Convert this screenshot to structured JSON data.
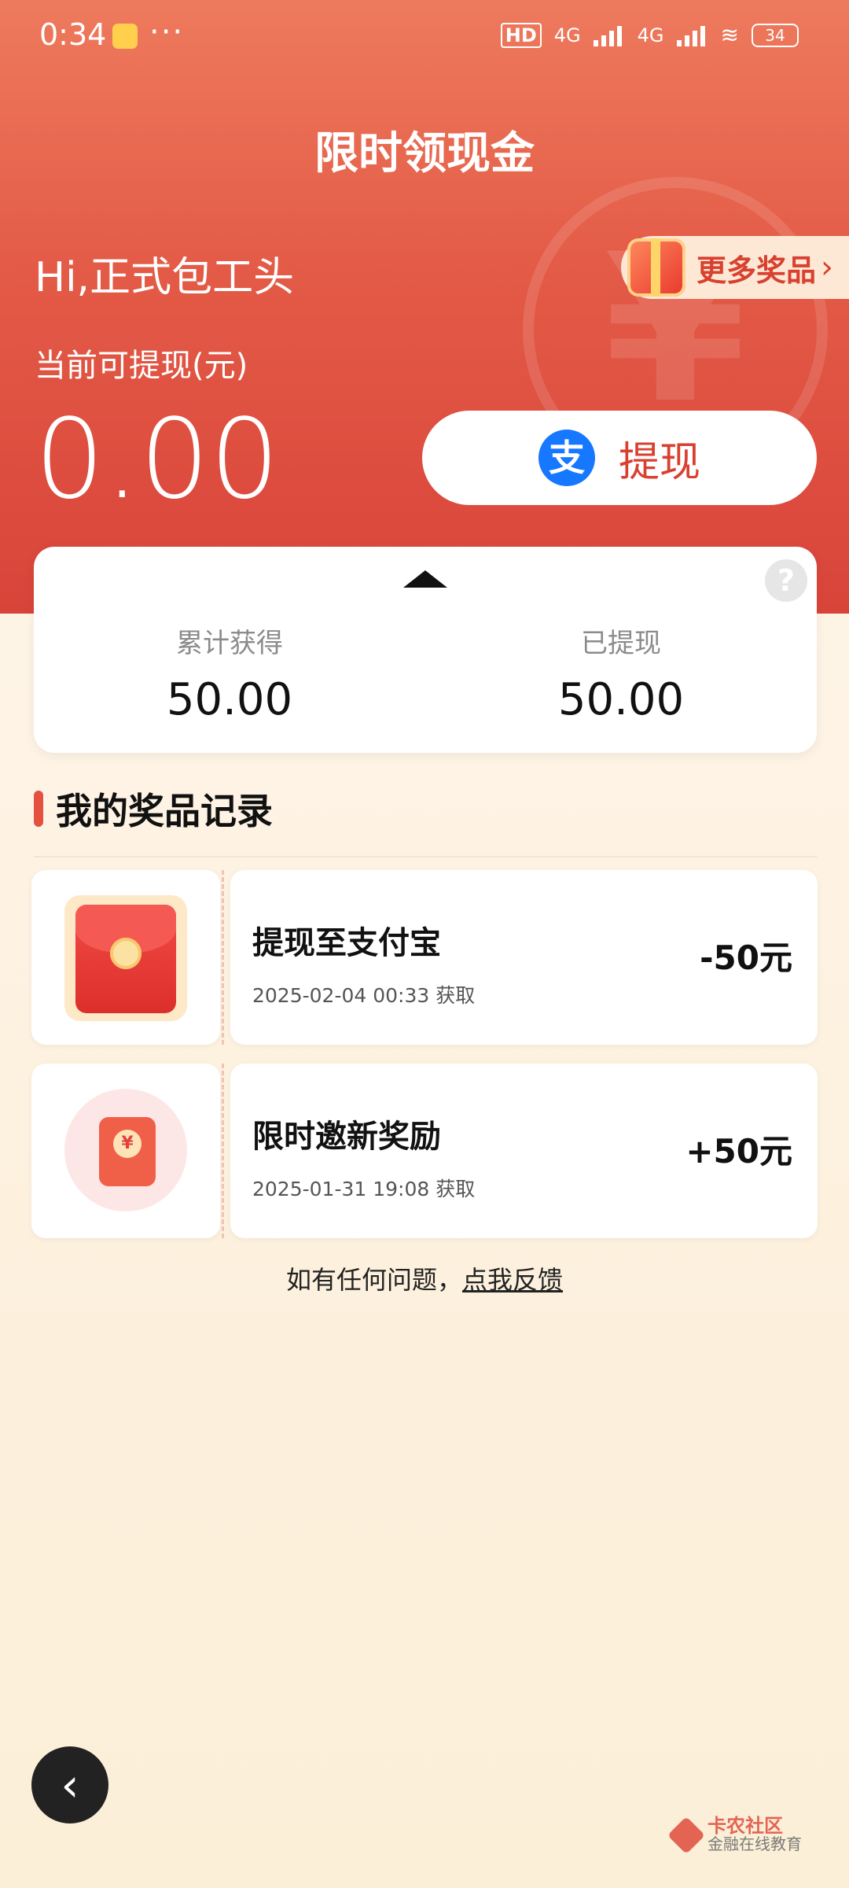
{
  "status_bar": {
    "time": "0:34",
    "more": "···",
    "network_1": "4G",
    "network_2": "4G",
    "battery": "34"
  },
  "header": {
    "title": "限时领现金"
  },
  "user": {
    "greeting": "Hi,正式包工头"
  },
  "more_prizes": {
    "label": "更多奖品",
    "chevron": "›"
  },
  "balance": {
    "label": "当前可提现(元)",
    "value": "0.00"
  },
  "withdraw": {
    "label": "提现",
    "icon": "alipay-icon"
  },
  "stats": {
    "help_symbol": "?",
    "total_label": "累计获得",
    "total_value": "50.00",
    "withdrawn_label": "已提现",
    "withdrawn_value": "50.00"
  },
  "records": {
    "section_title": "我的奖品记录",
    "items": [
      {
        "name": "提现至支付宝",
        "date": "2025-02-04 00:33 获取",
        "amount": "-50元"
      },
      {
        "name": "限时邀新奖励",
        "date": "2025-01-31 19:08 获取",
        "amount": "+50元"
      }
    ]
  },
  "footer": {
    "prefix": "如有任何问题，",
    "link": "点我反馈"
  },
  "back": {
    "symbol": "‹"
  },
  "brand": {
    "name": "卡农社区",
    "tagline": "金融在线教育"
  },
  "colors": {
    "accent": "#e35a46",
    "link": "#1677ff",
    "highlight": "#d8402f"
  }
}
